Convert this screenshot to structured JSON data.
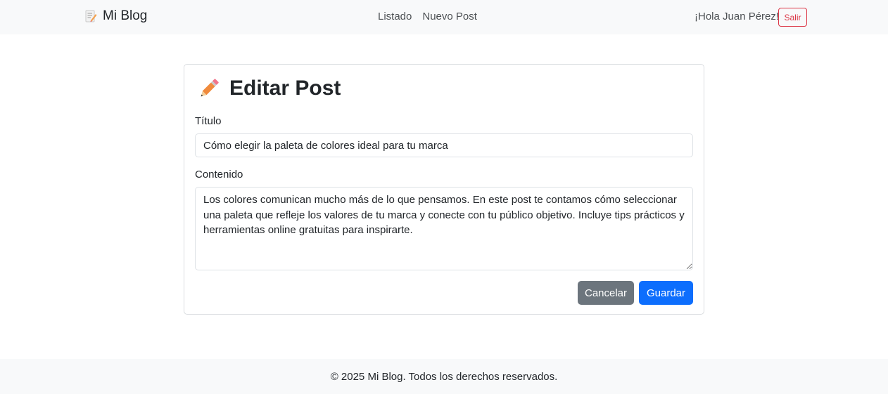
{
  "navbar": {
    "brand": "Mi Blog",
    "brand_icon": "memo-icon",
    "links": [
      "Listado",
      "Nuevo Post"
    ],
    "greeting": "¡Hola Juan Pérez!",
    "logout_label": "Salir"
  },
  "form": {
    "title": "Editar Post",
    "title_icon": "pencil-icon",
    "title_label": "Título",
    "title_value": "Cómo elegir la paleta de colores ideal para tu marca",
    "content_label": "Contenido",
    "content_value": "Los colores comunican mucho más de lo que pensamos. En este post te contamos cómo seleccionar una paleta que refleje los valores de tu marca y conecte con tu público objetivo. Incluye tips prácticos y herramientas online gratuitas para inspirarte.",
    "cancel_label": "Cancelar",
    "save_label": "Guardar"
  },
  "footer": {
    "text": "© 2025 Mi Blog. Todos los derechos reservados."
  },
  "colors": {
    "primary": "#0d6efd",
    "secondary": "#6c757d",
    "danger": "#dc3545",
    "light": "#f8f9fa"
  }
}
